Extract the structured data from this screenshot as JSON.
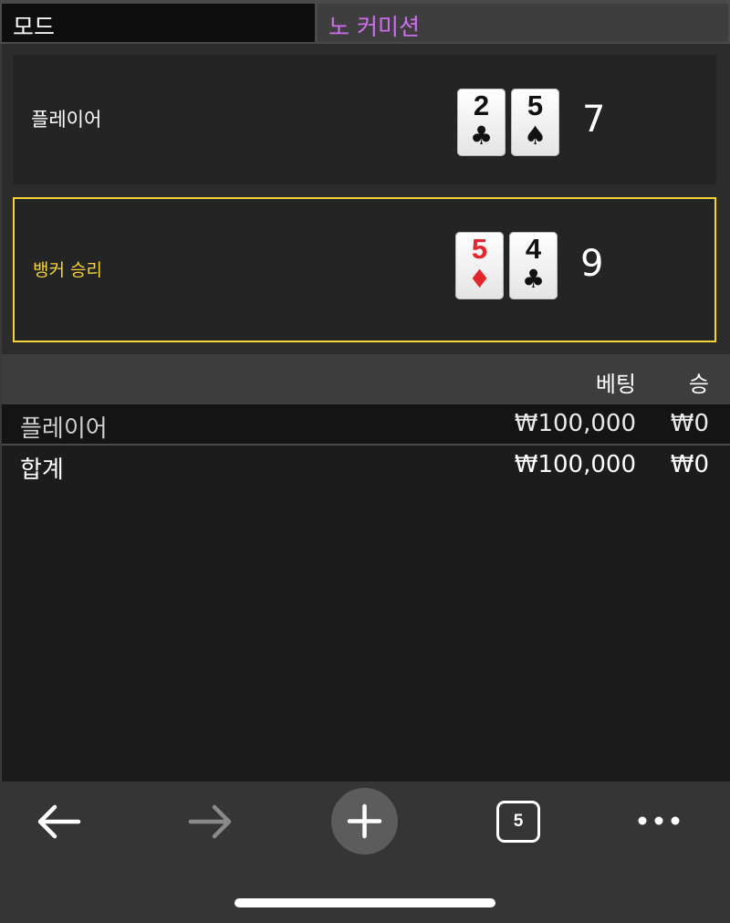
{
  "mode": {
    "label": "모드",
    "value": "노 커미션"
  },
  "hands": {
    "player": {
      "label": "플레이어",
      "cards": [
        {
          "rank": "2",
          "suit": "♣",
          "color": "black"
        },
        {
          "rank": "5",
          "suit": "♠",
          "color": "black"
        }
      ],
      "score": "7"
    },
    "banker": {
      "label": "뱅커 승리",
      "cards": [
        {
          "rank": "5",
          "suit": "♦",
          "color": "red"
        },
        {
          "rank": "4",
          "suit": "♣",
          "color": "black"
        }
      ],
      "score": "9"
    }
  },
  "bet_table": {
    "headers": {
      "bet": "베팅",
      "win": "승"
    },
    "rows": [
      {
        "name": "플레이어",
        "bet": "₩100,000",
        "win": "₩0"
      },
      {
        "name": "합계",
        "bet": "₩100,000",
        "win": "₩0"
      }
    ]
  },
  "toolbar": {
    "tab_count": "5",
    "icons": [
      "back-arrow-icon",
      "forward-arrow-icon",
      "plus-icon",
      "tabs-icon",
      "more-icon"
    ]
  },
  "colors": {
    "mode_value": "#cf6ff0",
    "banker_highlight": "#f5d33a",
    "red_suit": "#e3262b"
  }
}
